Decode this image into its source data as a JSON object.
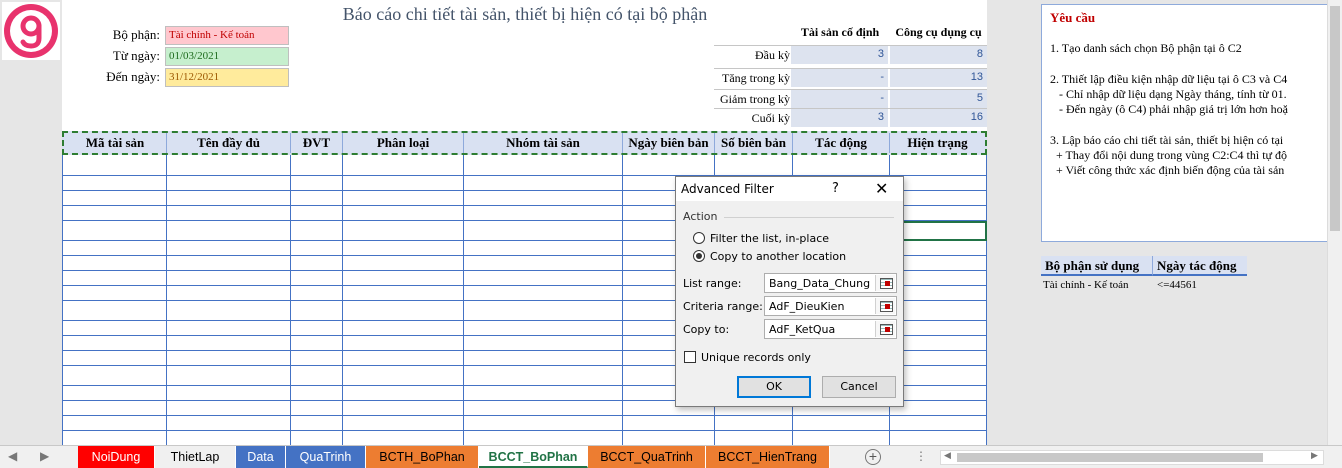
{
  "report": {
    "title": "Báo cáo chi tiết tài sản, thiết bị hiện có tại bộ phận",
    "fields": [
      {
        "label": "Bộ phận:",
        "value": "Tài chính - Kế toán"
      },
      {
        "label": "Từ ngày:",
        "value": "01/03/2021"
      },
      {
        "label": "Đến ngày:",
        "value": "31/12/2021"
      }
    ]
  },
  "summary": {
    "headers": [
      "Tài sản cố định",
      "Công cụ dụng cụ"
    ],
    "rows": [
      {
        "label": "Đầu kỳ",
        "a": "3",
        "b": "8"
      },
      {
        "label": "Tăng trong kỳ",
        "a": "-",
        "b": "13"
      },
      {
        "label": "Giảm trong kỳ",
        "a": "-",
        "b": "5"
      },
      {
        "label": "Cuối kỳ",
        "a": "3",
        "b": "16"
      }
    ]
  },
  "table": {
    "columns": [
      "Mã tài sản",
      "Tên đầy đủ",
      "ĐVT",
      "Phân loại",
      "Nhóm tài sản",
      "Ngày biên bản",
      "Số biên bản",
      "Tác động",
      "Hiện trạng"
    ]
  },
  "requirements": {
    "title": "Yêu cầu",
    "lines": [
      "1. Tạo danh sách chọn Bộ phận tại ô C2",
      "2. Thiết lập điều kiện nhập dữ liệu tại ô C3 và C4",
      "   - Chỉ nhập dữ liệu dạng Ngày tháng, tính từ 01.",
      "   - Đến ngày (ô C4) phải nhập giá trị lớn hơn hoặ",
      "3. Lập báo cáo chi tiết tài sản, thiết bị hiện có tại",
      "  + Thay đổi nội dung trong vùng C2:C4 thì tự độ",
      "  + Viết công thức xác định biến động của tài sản"
    ]
  },
  "criteria": {
    "headers": [
      "Bộ phận sử dụng",
      "Ngày tác động"
    ],
    "values": [
      "Tài chính - Kế toán",
      "<=44561"
    ]
  },
  "dialog": {
    "title": "Advanced Filter",
    "help": "?",
    "close": "✕",
    "section": "Action",
    "options": [
      "Filter the list, in-place",
      "Copy to another location"
    ],
    "selected_option": "Copy to another location",
    "list_range_label": "List range:",
    "list_range": "Bang_Data_Chung",
    "criteria_range_label": "Criteria range:",
    "criteria_range": "AdF_DieuKien",
    "copy_to_label": "Copy to:",
    "copy_to": "AdF_KetQua",
    "unique_label": "Unique records only",
    "unique_checked": false,
    "ok": "OK",
    "cancel": "Cancel"
  },
  "tabs": {
    "items": [
      {
        "label": "NoiDung",
        "color": "#ff0000",
        "text": "#ffffff"
      },
      {
        "label": "ThietLap",
        "color": "#f0f0f0",
        "text": "#000000"
      },
      {
        "label": "Data",
        "color": "#4472c4",
        "text": "#ffffff"
      },
      {
        "label": "QuaTrinh",
        "color": "#4472c4",
        "text": "#ffffff"
      },
      {
        "label": "BCTH_BoPhan",
        "color": "#ed7d31",
        "text": "#000000"
      },
      {
        "label": "BCCT_BoPhan",
        "color": "#ffffff",
        "text": "#217346"
      },
      {
        "label": "BCCT_QuaTrinh",
        "color": "#ed7d31",
        "text": "#000000"
      },
      {
        "label": "BCCT_HienTrang",
        "color": "#ed7d31",
        "text": "#000000"
      }
    ],
    "active": "BCCT_BoPhan",
    "add_icon": "plus-circle-icon"
  }
}
